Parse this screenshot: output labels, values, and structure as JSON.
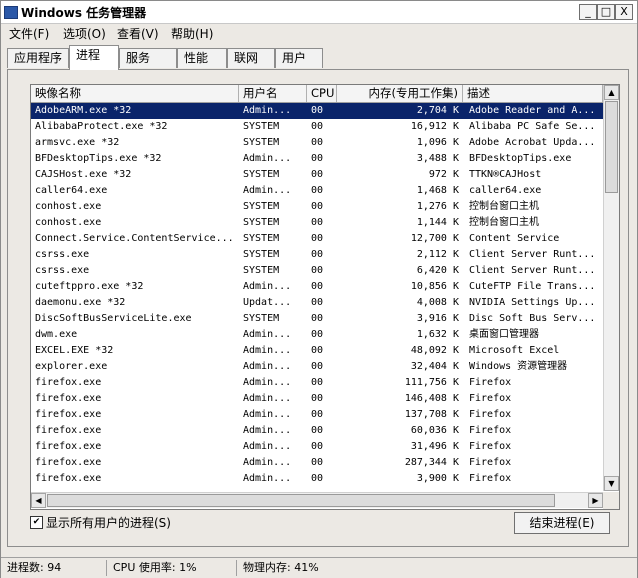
{
  "window": {
    "title": "Windows 任务管理器",
    "minimize_label": "_",
    "maximize_label": "□",
    "close_label": "X"
  },
  "menu": [
    "文件(F)",
    "选项(O)",
    "查看(V)",
    "帮助(H)"
  ],
  "tabs": [
    "应用程序",
    "进程",
    "服务",
    "性能",
    "联网",
    "用户"
  ],
  "active_tab": 1,
  "columns": {
    "name": "映像名称",
    "user": "用户名",
    "cpu": "CPU",
    "mem": "内存(专用工作集)",
    "desc": "描述"
  },
  "processes": [
    {
      "name": "AdobeARM.exe *32",
      "user": "Admin...",
      "cpu": "00",
      "mem": "2,704 K",
      "desc": "Adobe Reader and A...",
      "selected": true
    },
    {
      "name": "AlibabaProtect.exe *32",
      "user": "SYSTEM",
      "cpu": "00",
      "mem": "16,912 K",
      "desc": "Alibaba PC Safe Se..."
    },
    {
      "name": "armsvc.exe *32",
      "user": "SYSTEM",
      "cpu": "00",
      "mem": "1,096 K",
      "desc": "Adobe Acrobat Upda..."
    },
    {
      "name": "BFDesktopTips.exe *32",
      "user": "Admin...",
      "cpu": "00",
      "mem": "3,488 K",
      "desc": "BFDesktopTips.exe"
    },
    {
      "name": "CAJSHost.exe *32",
      "user": "SYSTEM",
      "cpu": "00",
      "mem": "972 K",
      "desc": "TTKN®CAJHost"
    },
    {
      "name": "caller64.exe",
      "user": "Admin...",
      "cpu": "00",
      "mem": "1,468 K",
      "desc": "caller64.exe"
    },
    {
      "name": "conhost.exe",
      "user": "SYSTEM",
      "cpu": "00",
      "mem": "1,276 K",
      "desc": "控制台窗口主机"
    },
    {
      "name": "conhost.exe",
      "user": "SYSTEM",
      "cpu": "00",
      "mem": "1,144 K",
      "desc": "控制台窗口主机"
    },
    {
      "name": "Connect.Service.ContentService...",
      "user": "SYSTEM",
      "cpu": "00",
      "mem": "12,700 K",
      "desc": "Content Service"
    },
    {
      "name": "csrss.exe",
      "user": "SYSTEM",
      "cpu": "00",
      "mem": "2,112 K",
      "desc": "Client Server Runt..."
    },
    {
      "name": "csrss.exe",
      "user": "SYSTEM",
      "cpu": "00",
      "mem": "6,420 K",
      "desc": "Client Server Runt..."
    },
    {
      "name": "cuteftppro.exe *32",
      "user": "Admin...",
      "cpu": "00",
      "mem": "10,856 K",
      "desc": "CuteFTP File Trans..."
    },
    {
      "name": "daemonu.exe *32",
      "user": "Updat...",
      "cpu": "00",
      "mem": "4,008 K",
      "desc": "NVIDIA Settings Up..."
    },
    {
      "name": "DiscSoftBusServiceLite.exe",
      "user": "SYSTEM",
      "cpu": "00",
      "mem": "3,916 K",
      "desc": "Disc Soft Bus Serv..."
    },
    {
      "name": "dwm.exe",
      "user": "Admin...",
      "cpu": "00",
      "mem": "1,632 K",
      "desc": "桌面窗口管理器"
    },
    {
      "name": "EXCEL.EXE *32",
      "user": "Admin...",
      "cpu": "00",
      "mem": "48,092 K",
      "desc": "Microsoft Excel"
    },
    {
      "name": "explorer.exe",
      "user": "Admin...",
      "cpu": "00",
      "mem": "32,404 K",
      "desc": "Windows 资源管理器"
    },
    {
      "name": "firefox.exe",
      "user": "Admin...",
      "cpu": "00",
      "mem": "111,756 K",
      "desc": "Firefox"
    },
    {
      "name": "firefox.exe",
      "user": "Admin...",
      "cpu": "00",
      "mem": "146,408 K",
      "desc": "Firefox"
    },
    {
      "name": "firefox.exe",
      "user": "Admin...",
      "cpu": "00",
      "mem": "137,708 K",
      "desc": "Firefox"
    },
    {
      "name": "firefox.exe",
      "user": "Admin...",
      "cpu": "00",
      "mem": "60,036 K",
      "desc": "Firefox"
    },
    {
      "name": "firefox.exe",
      "user": "Admin...",
      "cpu": "00",
      "mem": "31,496 K",
      "desc": "Firefox"
    },
    {
      "name": "firefox.exe",
      "user": "Admin...",
      "cpu": "00",
      "mem": "287,344 K",
      "desc": "Firefox"
    },
    {
      "name": "firefox.exe",
      "user": "Admin...",
      "cpu": "00",
      "mem": "3,900 K",
      "desc": "Firefox"
    }
  ],
  "show_all_users": {
    "label": "显示所有用户的进程(S)",
    "checked": true
  },
  "end_process_label": "结束进程(E)",
  "status": {
    "processes": "进程数: 94",
    "cpu": "CPU 使用率: 1%",
    "memory": "物理内存: 41%"
  },
  "colors": {
    "selection": "#0a246a"
  },
  "icons": {
    "scroll_up": "▲",
    "scroll_down": "▼",
    "scroll_left": "◀",
    "scroll_right": "▶",
    "check": "✔"
  }
}
